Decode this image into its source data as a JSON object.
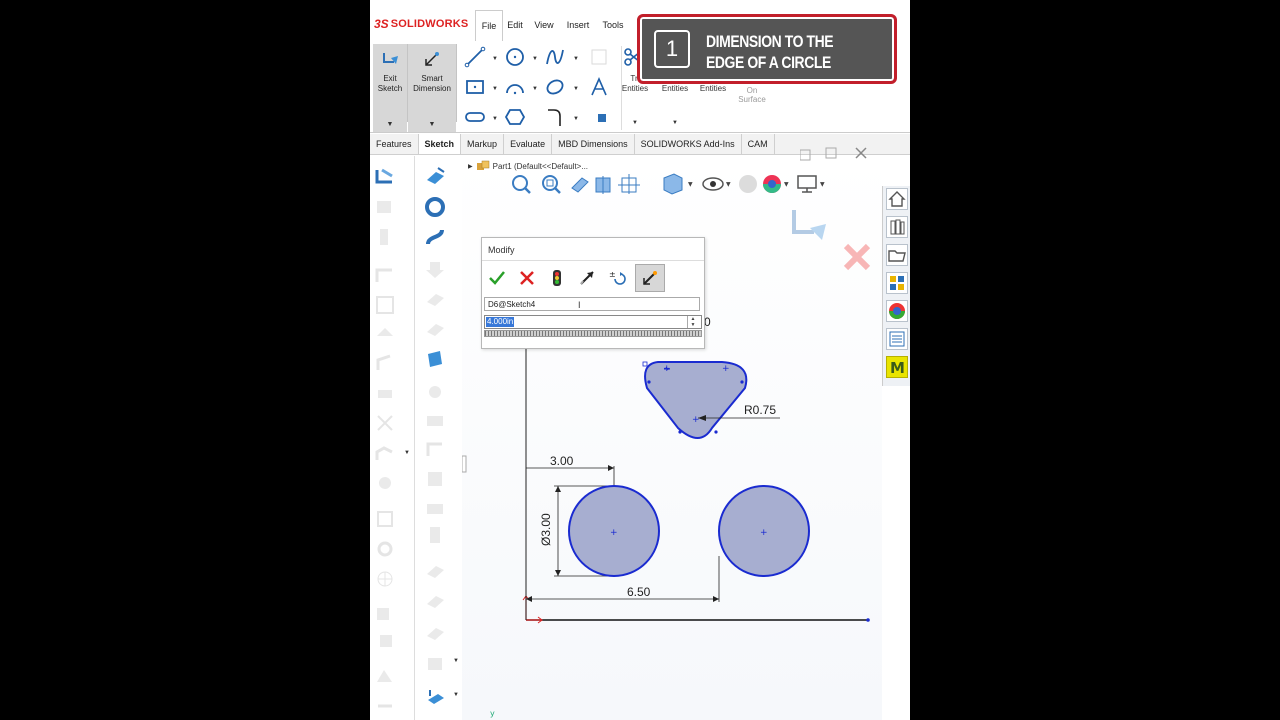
{
  "app": {
    "brand": "SOLIDWORKS",
    "ds_mark": "3S"
  },
  "menu": {
    "file": "File",
    "edit": "Edit",
    "view": "View",
    "insert": "Insert",
    "tools": "Tools"
  },
  "ribbon": {
    "exit_sketch": "Exit Sketch",
    "smart_dimension": "Smart Dimension",
    "trim_fragment": "Tr",
    "entities_1": "Entities",
    "entities_2": "Entities",
    "entities_3": "Entities",
    "on_surface_1": "On",
    "on_surface_2": "Surface"
  },
  "tabs": [
    "Features",
    "Sketch",
    "Markup",
    "Evaluate",
    "MBD Dimensions",
    "SOLIDWORKS Add-Ins",
    "CAM"
  ],
  "active_tab": "Sketch",
  "tree": {
    "part_label": "Part1  (Default<<Default>..."
  },
  "modify_dialog": {
    "title": "Modify",
    "dimension_name": "D6@Sketch4",
    "value": "4.000in"
  },
  "sketch": {
    "dim_top_partial": "0",
    "dim_radius": "R0.75",
    "dim_horizontal": "3.00",
    "dim_diameter": "Ø3.00",
    "dim_center_distance": "6.50"
  },
  "callout": {
    "number": "1",
    "text": "DIMENSION TO THE EDGE OF A CIRCLE"
  },
  "colors": {
    "sketch_fill": "#a7aed0",
    "sketch_line": "#1a2bd0",
    "callout_border": "#c21f2b",
    "callout_bg": "#555555",
    "brand_red": "#d22222"
  }
}
